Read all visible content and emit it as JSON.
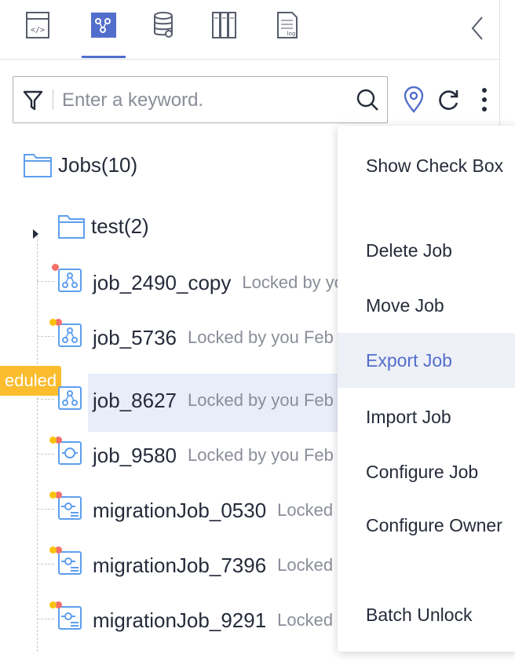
{
  "toolbar": {
    "tabs": [
      {
        "icon": "code-file-icon"
      },
      {
        "icon": "job-flow-icon",
        "active": true
      },
      {
        "icon": "database-icon"
      },
      {
        "icon": "library-icon"
      },
      {
        "icon": "log-file-icon"
      }
    ],
    "collapse_icon": "chevron-left-icon"
  },
  "search": {
    "placeholder": "Enter a keyword.",
    "value": ""
  },
  "tree": {
    "root": {
      "label": "Jobs",
      "count": "(10)"
    },
    "folders": [
      {
        "label": "test",
        "count": "(2)"
      }
    ],
    "jobs": [
      {
        "name": "job_2490_copy",
        "meta": "Locked by yo",
        "icon": "flow-job-icon",
        "status": "red"
      },
      {
        "name": "job_5736",
        "meta": "Locked by you  Feb",
        "icon": "flow-job-icon",
        "status": "mixed"
      },
      {
        "name": "job_8627",
        "meta": "Locked by you  Feb",
        "icon": "flow-job-icon",
        "status": "",
        "selected": true,
        "badge": "eduled"
      },
      {
        "name": "job_9580",
        "meta": "Locked by you  Feb",
        "icon": "sync-job-icon",
        "status": "mixed"
      },
      {
        "name": "migrationJob_0530",
        "meta": "Locked b",
        "icon": "migration-job-icon",
        "status": "mixed"
      },
      {
        "name": "migrationJob_7396",
        "meta": "Locked b",
        "icon": "migration-job-icon",
        "status": "mixed"
      },
      {
        "name": "migrationJob_9291",
        "meta": "Locked b",
        "icon": "migration-job-icon",
        "status": "mixed"
      }
    ]
  },
  "menu": {
    "items": [
      {
        "label": "Show Check Box"
      },
      {
        "label": "Delete Job"
      },
      {
        "label": "Move Job"
      },
      {
        "label": "Export Job",
        "hover": true
      },
      {
        "label": "Import Job"
      },
      {
        "label": "Configure Job"
      },
      {
        "label": "Configure Owner"
      },
      {
        "label": "Batch Unlock"
      }
    ]
  },
  "colors": {
    "accent": "#526ecc",
    "icon_blue": "#5e9fee",
    "status_red": "#f66f6a",
    "status_yellow": "#fac20a",
    "badge": "#fbbc2e"
  }
}
